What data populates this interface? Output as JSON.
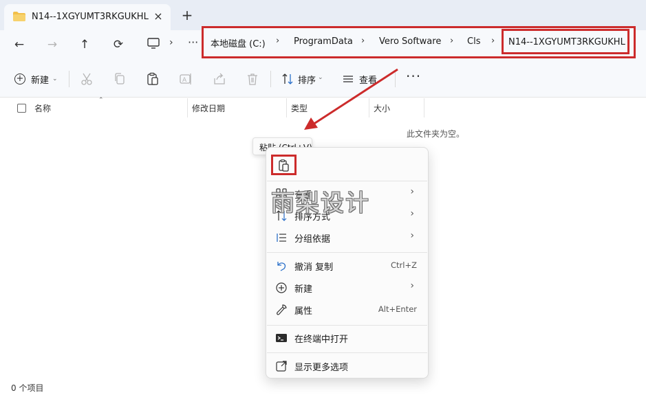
{
  "tab": {
    "title": "N14--1XGYUMT3RKGUKHL",
    "close_icon": "×",
    "new_icon": "+"
  },
  "nav": {
    "back_icon": "←",
    "forward_icon": "→",
    "up_icon": "↑",
    "refresh_icon": "⟳",
    "chevron": "›",
    "more": "···",
    "breadcrumbs": [
      "本地磁盘 (C:)",
      "ProgramData",
      "Vero Software",
      "Cls",
      "N14--1XGYUMT3RKGUKHL"
    ]
  },
  "commandbar": {
    "new_label": "新建",
    "sort_label": "排序",
    "view_label": "查看",
    "more_label": "···"
  },
  "columns": {
    "name": "名称",
    "modified": "修改日期",
    "type": "类型",
    "size": "大小"
  },
  "empty_message": "此文件夹为空。",
  "status_bar": "0 个项目",
  "tooltip": "粘贴 (Ctrl+V)",
  "context_menu": {
    "items": [
      {
        "label": "查看",
        "icon": "grid-view-icon",
        "submenu": true
      },
      {
        "label": "排序方式",
        "icon": "sort-icon",
        "submenu": true
      },
      {
        "label": "分组依据",
        "icon": "group-list-icon",
        "submenu": true
      },
      {
        "label": "撤消 复制",
        "icon": "undo-icon",
        "shortcut": "Ctrl+Z"
      },
      {
        "label": "新建",
        "icon": "new-plus-icon",
        "submenu": true
      },
      {
        "label": "属性",
        "icon": "wrench-icon",
        "shortcut": "Alt+Enter"
      },
      {
        "label": "在终端中打开",
        "icon": "terminal-icon"
      },
      {
        "label": "显示更多选项",
        "icon": "expand-icon"
      }
    ],
    "submenu_arrow": "›"
  },
  "watermark": "雨梨设计",
  "colors": {
    "highlight_red": "#cc2b2b",
    "tab_bar": "#e8edf5",
    "toolbar": "#f7f9fc",
    "folder": "#f2c04a"
  }
}
